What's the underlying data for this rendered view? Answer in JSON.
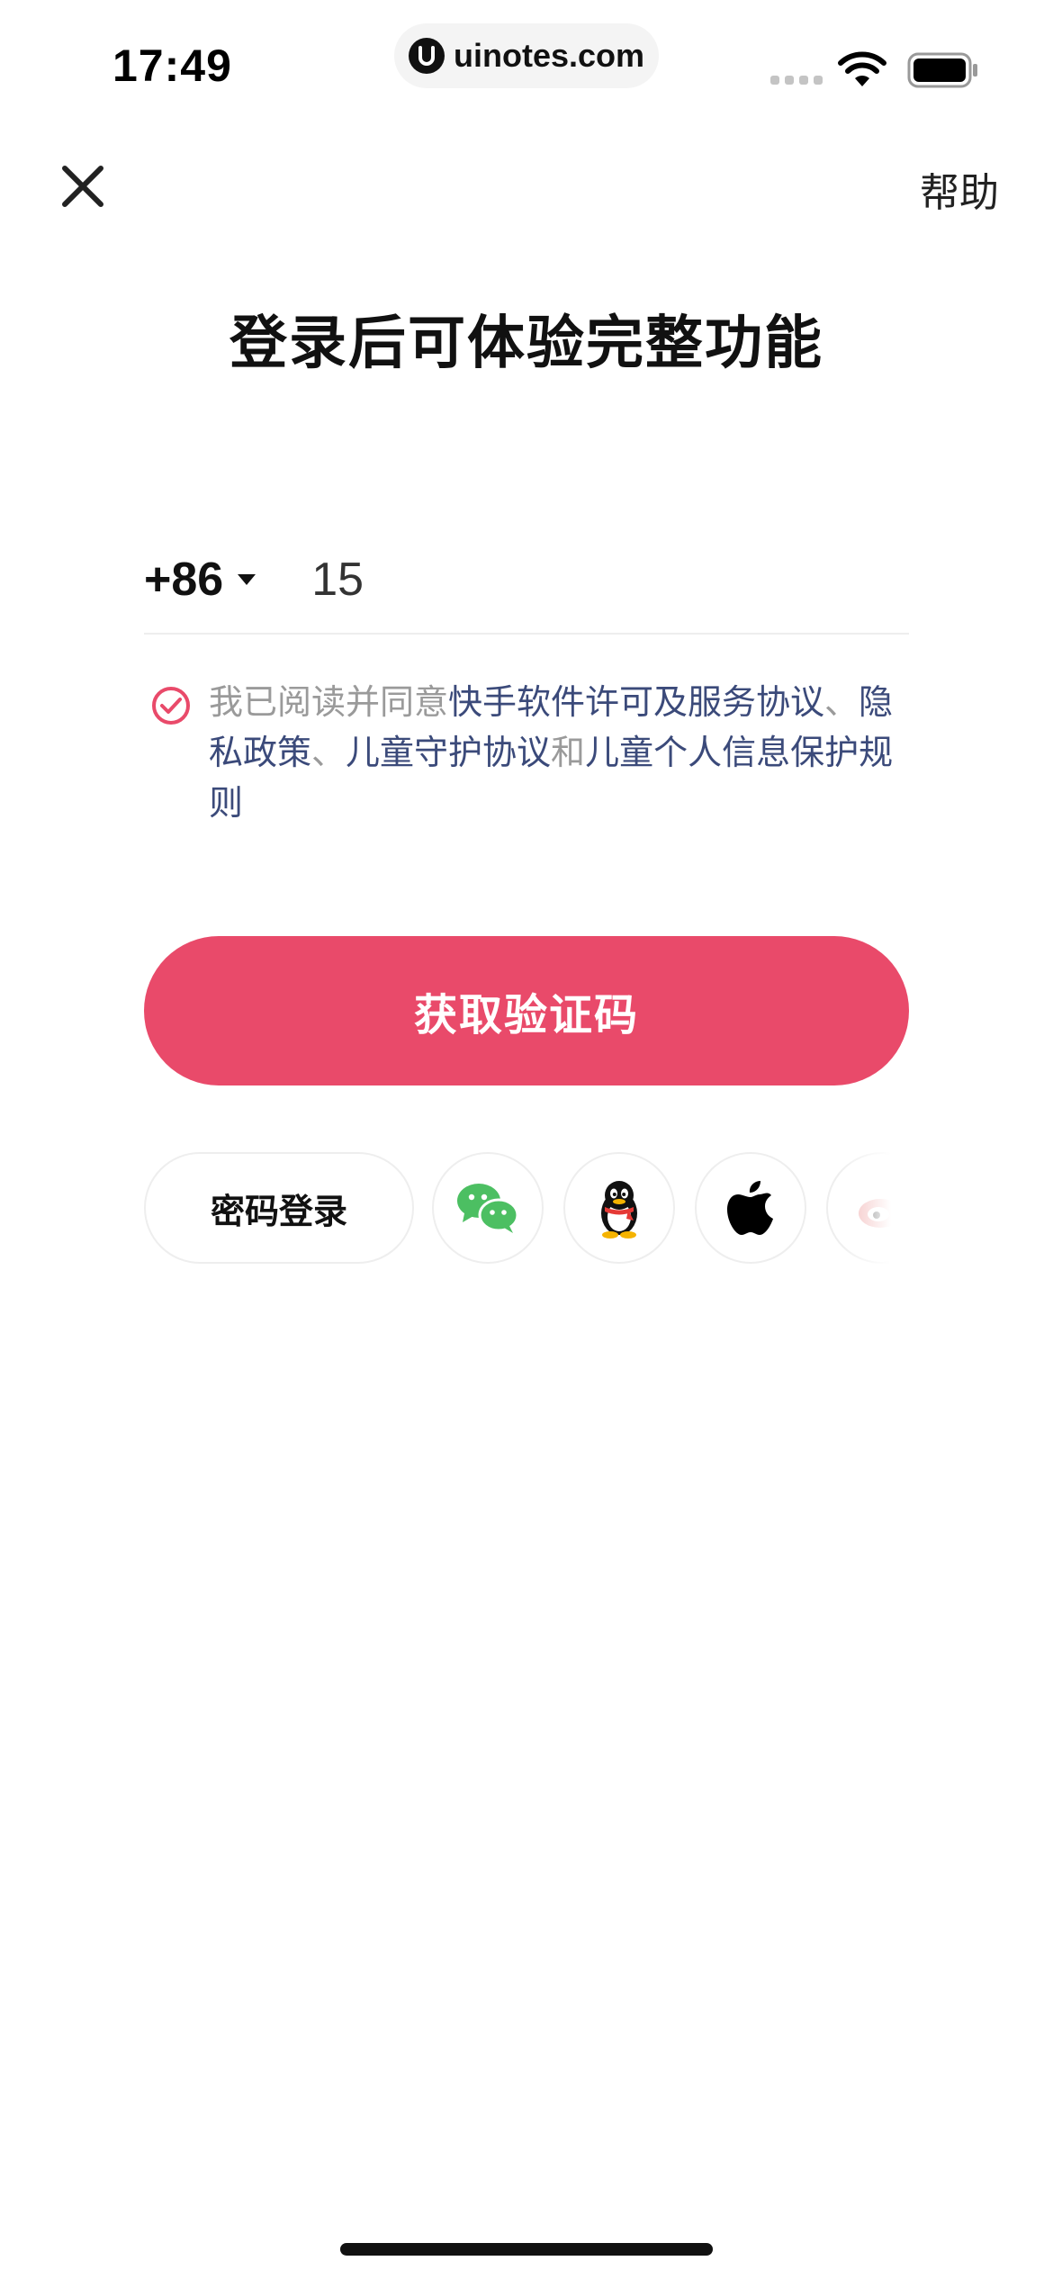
{
  "status_bar": {
    "time": "17:49",
    "url": "uinotes.com"
  },
  "nav": {
    "help_label": "帮助"
  },
  "title": "登录后可体验完整功能",
  "phone": {
    "country_code": "+86",
    "value": "15"
  },
  "agreement": {
    "prefix": "我已阅读并同意",
    "link1": "快手软件许可及服务协议",
    "sep1": "、",
    "link2": "隐私政策",
    "sep2": "、",
    "link3": "儿童守护协议",
    "and": "和",
    "link4": "儿童个人信息保护规则"
  },
  "primary_button": {
    "label": "获取验证码"
  },
  "alt_login": {
    "password_label": "密码登录",
    "options": [
      "wechat-icon",
      "qq-icon",
      "apple-icon",
      "weibo-icon"
    ]
  },
  "colors": {
    "accent": "#e94a6a",
    "link": "#3b4a7a",
    "muted": "#9a9a9a"
  }
}
